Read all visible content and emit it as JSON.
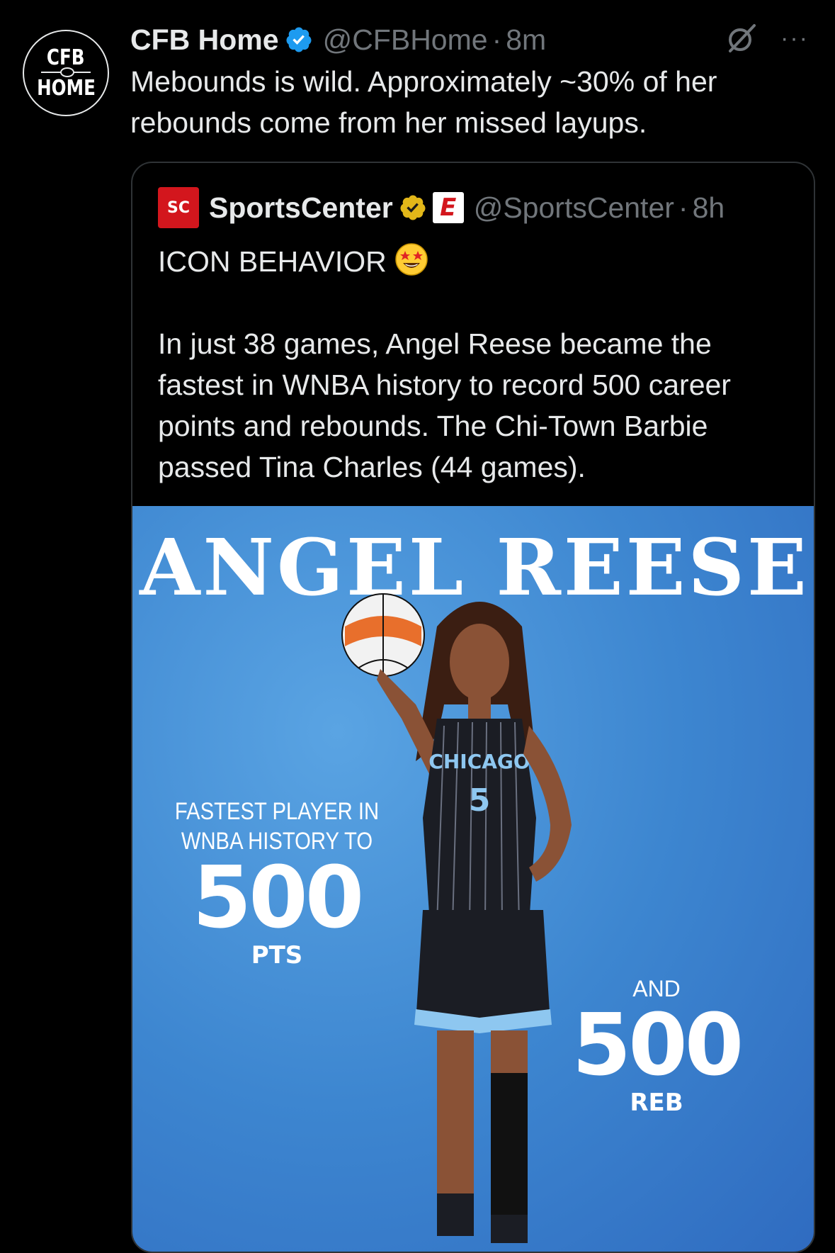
{
  "tweet": {
    "avatar": {
      "line1": "CFB",
      "line2": "HOME"
    },
    "display_name": "CFB Home",
    "handle": "@CFBHome",
    "separator": "·",
    "time": "8m",
    "text": "Mebounds is wild. Approximately ~30% of her rebounds come from her missed layups."
  },
  "quote": {
    "logo_text": "SC",
    "display_name": "SportsCenter",
    "handle": "@SportsCenter",
    "separator": "·",
    "time": "8h",
    "badge_letter": "E",
    "line1": "ICON BEHAVIOR",
    "line1_emoji": "star-struck-emoji",
    "body": "In just 38 games, Angel Reese became the fastest in WNBA history to record 500 career points and rebounds. The Chi-Town Barbie passed Tina Charles (44 games)."
  },
  "media": {
    "title": "ANGEL REESE",
    "stat1": {
      "label_line1": "FASTEST PLAYER IN",
      "label_line2": "WNBA HISTORY TO",
      "value": "500",
      "unit": "PTS"
    },
    "stat2": {
      "label": "AND",
      "value": "500",
      "unit": "REB"
    },
    "jersey_text": "CHICAGO",
    "jersey_number": "5"
  },
  "colors": {
    "background": "#000000",
    "text_primary": "#e7e9ea",
    "text_secondary": "#71767b",
    "verified_blue": "#1d9bf0",
    "verified_gold": "#e2b719",
    "espn_red": "#d3161d",
    "media_blue": "#3d86d0"
  },
  "icons": [
    "verified-badge-icon",
    "grok-icon",
    "more-options-icon",
    "gold-verified-badge-icon",
    "espn-badge-icon"
  ]
}
